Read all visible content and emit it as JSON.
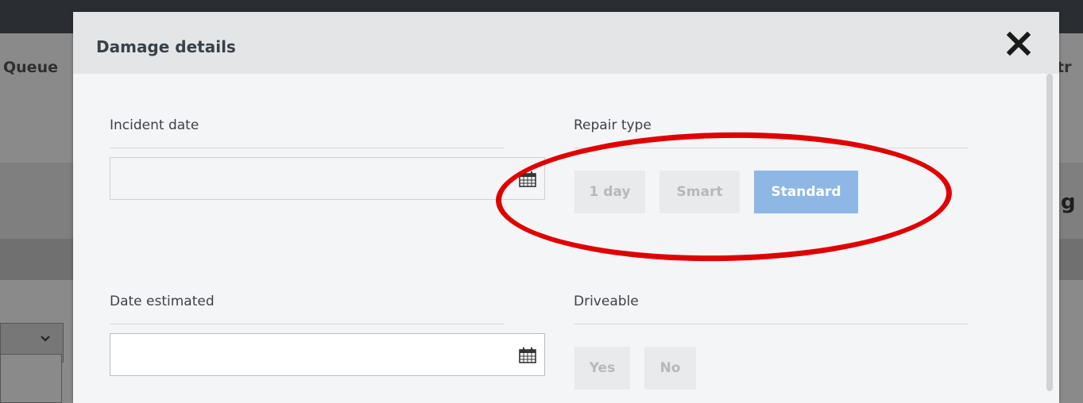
{
  "background": {
    "left_tab_label": "Queue",
    "right_header_fragment": "tr",
    "right_glyph": "g"
  },
  "modal": {
    "title": "Damage details",
    "close_icon": "close-icon",
    "fields": {
      "incident_date": {
        "label": "Incident date",
        "value": "",
        "icon": "calendar-icon"
      },
      "repair_type": {
        "label": "Repair type",
        "options": [
          "1 day",
          "Smart",
          "Standard"
        ],
        "selected": "Standard"
      },
      "date_estimated": {
        "label": "Date estimated",
        "value": "",
        "icon": "calendar-icon"
      },
      "driveable": {
        "label": "Driveable",
        "options": [
          "Yes",
          "No"
        ],
        "selected": ""
      }
    }
  },
  "colors": {
    "selected_button": "#8fb7e6",
    "annotation": "#e00000"
  }
}
